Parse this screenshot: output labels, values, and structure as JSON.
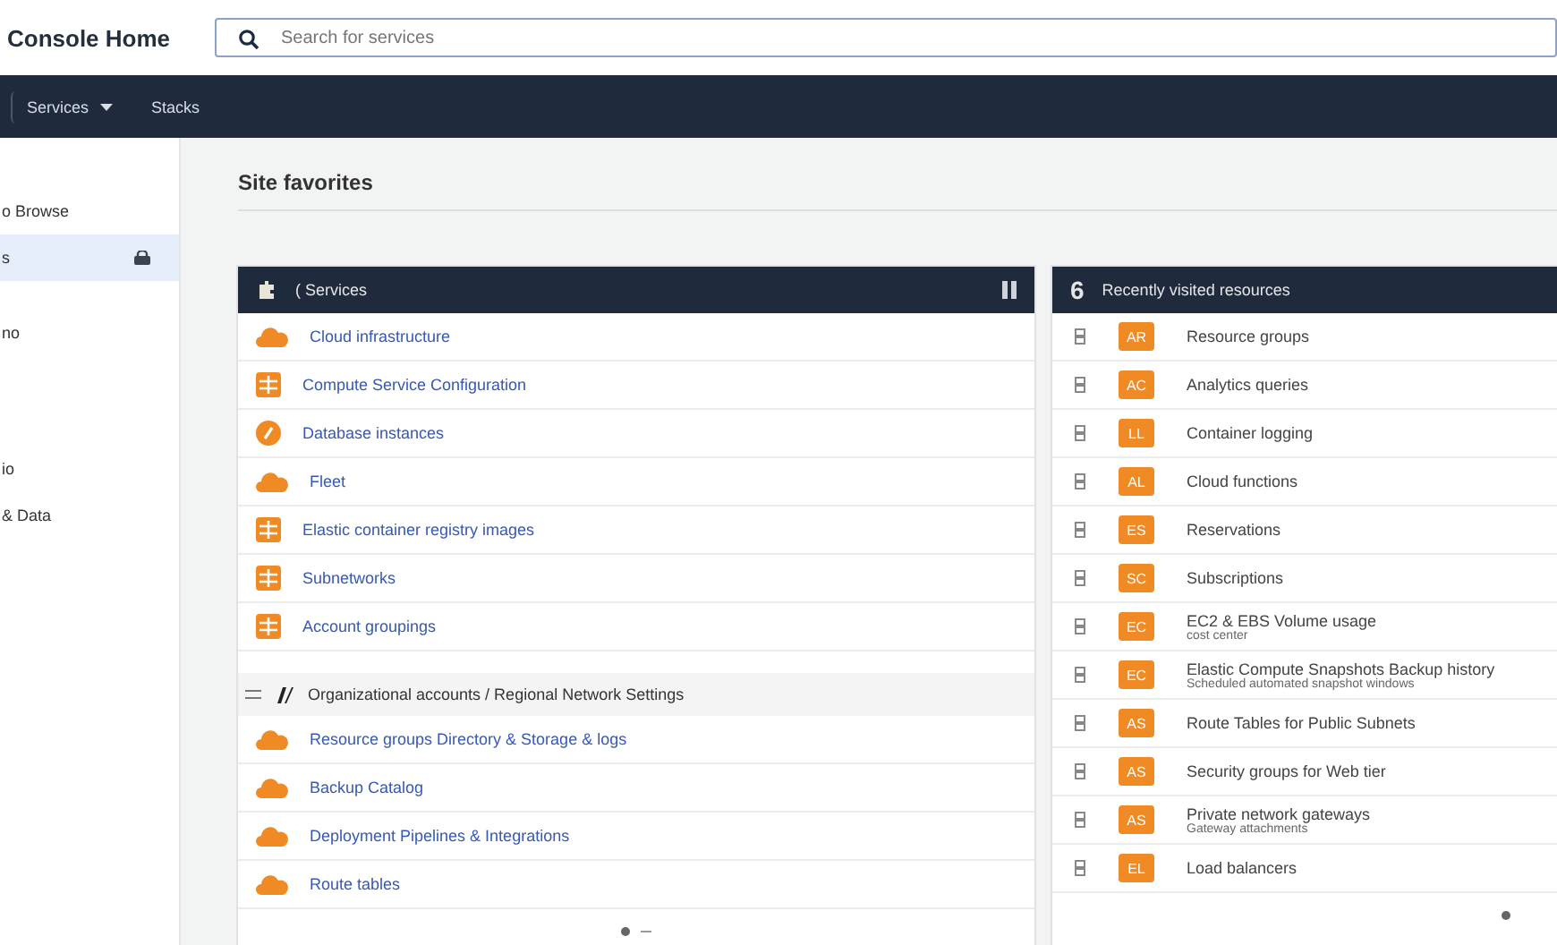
{
  "header": {
    "title": "Console Home",
    "search": {
      "placeholder": "Search for services"
    }
  },
  "nav": {
    "items": [
      {
        "label": "Services",
        "dropdown": true
      },
      {
        "label": "Stacks",
        "dropdown": false
      }
    ]
  },
  "sidebar": {
    "items": [
      {
        "label": "o Browse",
        "selected": false
      },
      {
        "label": "s",
        "selected": true
      },
      {
        "label": "no",
        "selected": false
      },
      {
        "label": "io",
        "selected": false
      },
      {
        "label": "& Data",
        "selected": false
      }
    ]
  },
  "page_title": "Site favorites",
  "services_panel": {
    "title": "( Services",
    "groups": [
      {
        "rows": [
          {
            "kind": "cloud",
            "label": "Cloud infrastructure"
          },
          {
            "kind": "grid",
            "label": "Compute Service Configuration"
          },
          {
            "kind": "circle",
            "label": "Database instances"
          },
          {
            "kind": "cloud",
            "label": "Fleet"
          },
          {
            "kind": "grid",
            "label": "Elastic container registry images"
          },
          {
            "kind": "grid",
            "label": "Subnetworks"
          },
          {
            "kind": "grid",
            "label": "Account groupings"
          }
        ]
      },
      {
        "heading": "Organizational accounts / Regional Network Settings",
        "rows": [
          {
            "kind": "cloud",
            "label": "Resource groups Directory & Storage & logs"
          },
          {
            "kind": "cloud",
            "label": "Backup Catalog"
          },
          {
            "kind": "cloud",
            "label": "Deployment Pipelines & Integrations"
          },
          {
            "kind": "cloud",
            "label": "Route tables"
          }
        ]
      }
    ]
  },
  "recent_panel": {
    "count": "6",
    "title": "Recently visited resources",
    "rows": [
      {
        "badge": "AR",
        "title": "Resource groups"
      },
      {
        "badge": "AC",
        "title": "Analytics queries"
      },
      {
        "badge": "LL",
        "title": "Container logging"
      },
      {
        "badge": "AL",
        "title": "Cloud functions"
      },
      {
        "badge": "ES",
        "title": "Reservations"
      },
      {
        "badge": "SC",
        "title": "Subscriptions"
      },
      {
        "badge": "EC",
        "title": "EC2 & EBS Volume usage",
        "subtitle": "cost center"
      },
      {
        "badge": "EC",
        "title": "Elastic Compute Snapshots Backup history",
        "subtitle": "Scheduled automated snapshot windows"
      },
      {
        "badge": "AS",
        "title": "Route Tables for Public Subnets"
      },
      {
        "badge": "AS",
        "title": "Security groups for Web tier"
      },
      {
        "badge": "AS",
        "title": "Private network gateways",
        "subtitle": "Gateway attachments"
      },
      {
        "badge": "EL",
        "title": "Load balancers"
      }
    ]
  }
}
